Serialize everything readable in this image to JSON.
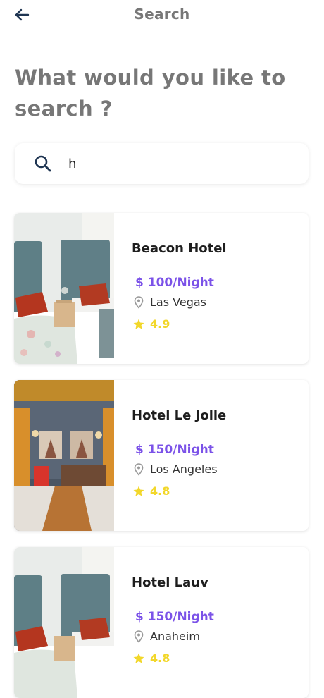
{
  "header": {
    "title": "Search",
    "back_icon": "arrow-left-icon"
  },
  "prompt": {
    "text": "What would you like to search ?"
  },
  "search": {
    "value": "h",
    "icon": "search-icon"
  },
  "results": [
    {
      "name": "Beacon Hotel",
      "price": "$ 100/Night",
      "location": "Las Vegas",
      "rating": "4.9"
    },
    {
      "name": "Hotel Le Jolie",
      "price": "$ 150/Night",
      "location": "Los Angeles",
      "rating": "4.8"
    },
    {
      "name": "Hotel Lauv",
      "price": "$ 150/Night",
      "location": "Anaheim",
      "rating": "4.8"
    }
  ],
  "colors": {
    "title_gray": "#777777",
    "price_purple": "#7b52e8",
    "rating_yellow": "#f2d72a",
    "icon_navy": "#1f3552"
  }
}
